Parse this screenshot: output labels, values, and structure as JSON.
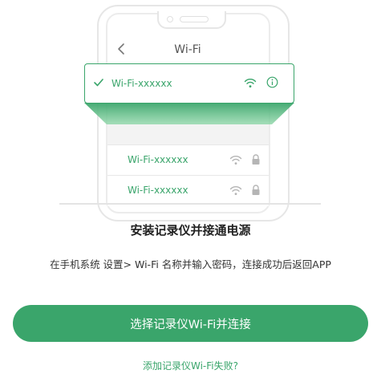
{
  "colors": {
    "accent": "#3aa56b",
    "text": "#222222",
    "muted": "#9a9a9a"
  },
  "illustration": {
    "screen_title": "Wi-Fi",
    "selected_network": {
      "ssid": "Wi-Fi-xxxxxx",
      "icons": [
        "check-icon",
        "wifi-signal-icon",
        "info-icon"
      ]
    },
    "networks": [
      {
        "ssid": "Wi-Fi-xxxxxx",
        "icons": [
          "wifi-signal-icon",
          "lock-icon"
        ]
      },
      {
        "ssid": "Wi-Fi-xxxxxx",
        "icons": [
          "wifi-signal-icon",
          "lock-icon"
        ]
      }
    ]
  },
  "heading": "安装记录仪并接通电源",
  "description": "在手机系统 设置> Wi-Fi 名称并输入密码，连接成功后返回APP",
  "primary_button": "选择记录仪Wi-Fi并连接",
  "help_link": "添加记录仪Wi-Fi失败?"
}
